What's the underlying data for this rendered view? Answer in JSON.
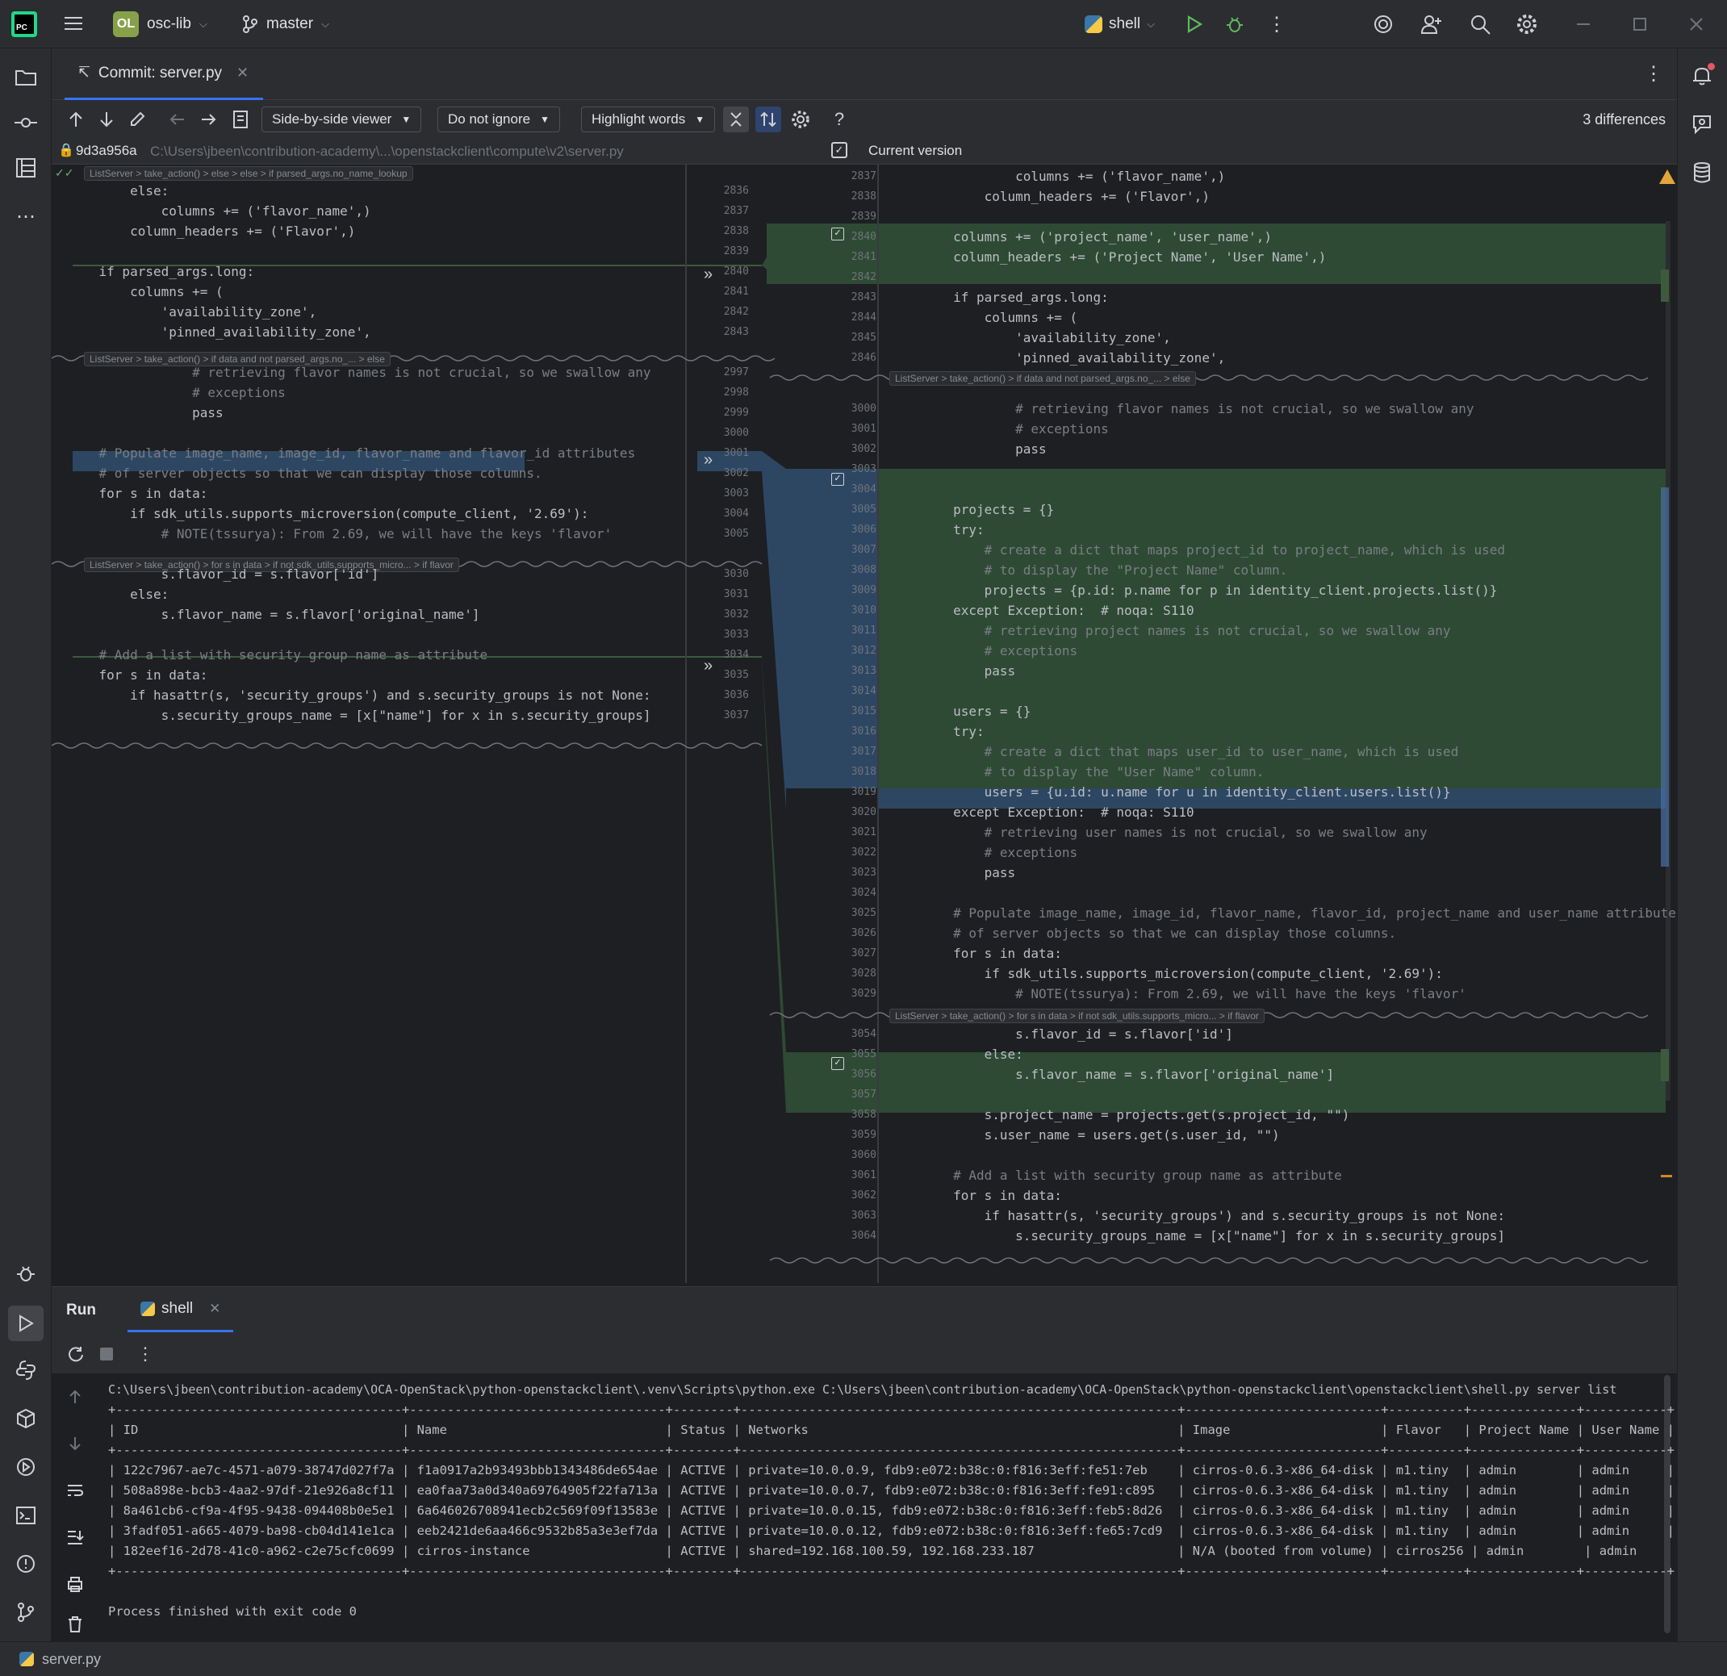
{
  "titlebar": {
    "project_badge": "OL",
    "project": "osc-lib",
    "branch": "master",
    "run_config": "shell"
  },
  "editor_tab": {
    "label": "Commit: server.py"
  },
  "toolbar": {
    "viewer": "Side-by-side viewer",
    "ignore": "Do not ignore",
    "highlight": "Highlight words",
    "differences": "3 differences"
  },
  "pathbar": {
    "revision": "9d3a956a",
    "path": "C:\\Users\\jbeen\\contribution-academy\\...\\openstackclient\\compute\\v2\\server.py",
    "current": "Current version"
  },
  "diff": {
    "left_crumbs": [
      "ListServer > take_action() > else > else > if parsed_args.no_name_lookup",
      "ListServer > take_action() > if data and not parsed_args.no_... > else",
      "ListServer > take_action() > for s in data > if not sdk_utils.supports_micro... > if flavor"
    ],
    "right_crumbs": [
      "ListServer > take_action() > if data and not parsed_args.no_... > else",
      "ListServer > take_action() > for s in data > if not sdk_utils.supports_micro... > if flavor"
    ],
    "left_lines": [
      {
        "n": "2836",
        "t": "        else:"
      },
      {
        "n": "2837",
        "t": "            columns += ('flavor_name',)"
      },
      {
        "n": "2838",
        "t": "        column_headers += ('Flavor',)"
      },
      {
        "n": "2839",
        "t": ""
      },
      {
        "n": "2840",
        "t": "    if parsed_args.long:"
      },
      {
        "n": "2841",
        "t": "        columns += ("
      },
      {
        "n": "2842",
        "t": "            'availability_zone',"
      },
      {
        "n": "2843",
        "t": "            'pinned_availability_zone',"
      },
      {
        "n": "2997",
        "t": "                # retrieving flavor names is not crucial, so we swallow any"
      },
      {
        "n": "2998",
        "t": "                # exceptions"
      },
      {
        "n": "2999",
        "t": "                pass"
      },
      {
        "n": "3000",
        "t": ""
      },
      {
        "n": "3001",
        "t": "    # Populate image_name, image_id, flavor_name and flavor_id attributes"
      },
      {
        "n": "3002",
        "t": "    # of server objects so that we can display those columns."
      },
      {
        "n": "3003",
        "t": "    for s in data:"
      },
      {
        "n": "3004",
        "t": "        if sdk_utils.supports_microversion(compute_client, '2.69'):"
      },
      {
        "n": "3005",
        "t": "            # NOTE(tssurya): From 2.69, we will have the keys 'flavor'"
      },
      {
        "n": "3030",
        "t": "            s.flavor_id = s.flavor['id']"
      },
      {
        "n": "3031",
        "t": "        else:"
      },
      {
        "n": "3032",
        "t": "            s.flavor_name = s.flavor['original_name']"
      },
      {
        "n": "3033",
        "t": ""
      },
      {
        "n": "3034",
        "t": "    # Add a list with security group name as attribute"
      },
      {
        "n": "3035",
        "t": "    for s in data:"
      },
      {
        "n": "3036",
        "t": "        if hasattr(s, 'security_groups') and s.security_groups is not None:"
      },
      {
        "n": "3037",
        "t": "            s.security_groups_name = [x[\"name\"] for x in s.security_groups]"
      }
    ],
    "right_lines": [
      {
        "n": "2837",
        "t": "                columns += ('flavor_name',)"
      },
      {
        "n": "2838",
        "t": "            column_headers += ('Flavor',)"
      },
      {
        "n": "2839",
        "t": ""
      },
      {
        "n": "2840",
        "t": "        columns += ('project_name', 'user_name',)"
      },
      {
        "n": "2841",
        "t": "        column_headers += ('Project Name', 'User Name',)"
      },
      {
        "n": "2842",
        "t": ""
      },
      {
        "n": "2843",
        "t": "        if parsed_args.long:"
      },
      {
        "n": "2844",
        "t": "            columns += ("
      },
      {
        "n": "2845",
        "t": "                'availability_zone',"
      },
      {
        "n": "2846",
        "t": "                'pinned_availability_zone',"
      },
      {
        "n": "3000",
        "t": "                # retrieving flavor names is not crucial, so we swallow any"
      },
      {
        "n": "3001",
        "t": "                # exceptions"
      },
      {
        "n": "3002",
        "t": "                pass"
      },
      {
        "n": "3003",
        "t": ""
      },
      {
        "n": "3004",
        "t": ""
      },
      {
        "n": "3005",
        "t": "        projects = {}"
      },
      {
        "n": "3006",
        "t": "        try:"
      },
      {
        "n": "3007",
        "t": "            # create a dict that maps project_id to project_name, which is used"
      },
      {
        "n": "3008",
        "t": "            # to display the \"Project Name\" column."
      },
      {
        "n": "3009",
        "t": "            projects = {p.id: p.name for p in identity_client.projects.list()}"
      },
      {
        "n": "3010",
        "t": "        except Exception:  # noqa: S110"
      },
      {
        "n": "3011",
        "t": "            # retrieving project names is not crucial, so we swallow any"
      },
      {
        "n": "3012",
        "t": "            # exceptions"
      },
      {
        "n": "3013",
        "t": "            pass"
      },
      {
        "n": "3014",
        "t": ""
      },
      {
        "n": "3015",
        "t": "        users = {}"
      },
      {
        "n": "3016",
        "t": "        try:"
      },
      {
        "n": "3017",
        "t": "            # create a dict that maps user_id to user_name, which is used"
      },
      {
        "n": "3018",
        "t": "            # to display the \"User Name\" column."
      },
      {
        "n": "3019",
        "t": "            users = {u.id: u.name for u in identity_client.users.list()}"
      },
      {
        "n": "3020",
        "t": "        except Exception:  # noqa: S110"
      },
      {
        "n": "3021",
        "t": "            # retrieving user names is not crucial, so we swallow any"
      },
      {
        "n": "3022",
        "t": "            # exceptions"
      },
      {
        "n": "3023",
        "t": "            pass"
      },
      {
        "n": "3024",
        "t": ""
      },
      {
        "n": "3025",
        "t": "        # Populate image_name, image_id, flavor_name, flavor_id, project_name and user_name attributes"
      },
      {
        "n": "3026",
        "t": "        # of server objects so that we can display those columns."
      },
      {
        "n": "3027",
        "t": "        for s in data:"
      },
      {
        "n": "3028",
        "t": "            if sdk_utils.supports_microversion(compute_client, '2.69'):"
      },
      {
        "n": "3029",
        "t": "                # NOTE(tssurya): From 2.69, we will have the keys 'flavor'"
      },
      {
        "n": "3054",
        "t": "                s.flavor_id = s.flavor['id']"
      },
      {
        "n": "3055",
        "t": "            else:"
      },
      {
        "n": "3056",
        "t": "                s.flavor_name = s.flavor['original_name']"
      },
      {
        "n": "3057",
        "t": ""
      },
      {
        "n": "3058",
        "t": "            s.project_name = projects.get(s.project_id, \"\")"
      },
      {
        "n": "3059",
        "t": "            s.user_name = users.get(s.user_id, \"\")"
      },
      {
        "n": "3060",
        "t": ""
      },
      {
        "n": "3061",
        "t": "        # Add a list with security group name as attribute"
      },
      {
        "n": "3062",
        "t": "        for s in data:"
      },
      {
        "n": "3063",
        "t": "            if hasattr(s, 'security_groups') and s.security_groups is not None:"
      },
      {
        "n": "3064",
        "t": "                s.security_groups_name = [x[\"name\"] for x in s.security_groups]"
      }
    ]
  },
  "run": {
    "tab_run": "Run",
    "tab_shell": "shell",
    "console": [
      "C:\\Users\\jbeen\\contribution-academy\\OCA-OpenStack\\python-openstackclient\\.venv\\Scripts\\python.exe C:\\Users\\jbeen\\contribution-academy\\OCA-OpenStack\\python-openstackclient\\openstackclient\\shell.py server list",
      "+--------------------------------------+----------------------------------+--------+----------------------------------------------------------+--------------------------+----------+--------------+-----------+",
      "| ID                                   | Name                             | Status | Networks                                                 | Image                    | Flavor   | Project Name | User Name |",
      "+--------------------------------------+----------------------------------+--------+----------------------------------------------------------+--------------------------+----------+--------------+-----------+",
      "| 122c7967-ae7c-4571-a079-38747d027f7a | f1a0917a2b93493bbb1343486de654ae | ACTIVE | private=10.0.0.9, fdb9:e072:b38c:0:f816:3eff:fe51:7eb    | cirros-0.6.3-x86_64-disk | m1.tiny  | admin        | admin     |",
      "| 508a898e-bcb3-4aa2-97df-21e926a8cf11 | ea0faa73a0d340a69764905f22fa713a | ACTIVE | private=10.0.0.7, fdb9:e072:b38c:0:f816:3eff:fe91:c895   | cirros-0.6.3-x86_64-disk | m1.tiny  | admin        | admin     |",
      "| 8a461cb6-cf9a-4f95-9438-094408b0e5e1 | 6a646026708941ecb2c569f09f13583e | ACTIVE | private=10.0.0.15, fdb9:e072:b38c:0:f816:3eff:feb5:8d26  | cirros-0.6.3-x86_64-disk | m1.tiny  | admin        | admin     |",
      "| 3fadf051-a665-4079-ba98-cb04d141e1ca | eeb2421de6aa466c9532b85a3e3ef7da | ACTIVE | private=10.0.0.12, fdb9:e072:b38c:0:f816:3eff:fe65:7cd9  | cirros-0.6.3-x86_64-disk | m1.tiny  | admin        | admin     |",
      "| 182eef16-2d78-41c0-a962-c2e75cfc0699 | cirros-instance                  | ACTIVE | shared=192.168.100.59, 192.168.233.187                   | N/A (booted from volume) | cirros256 | admin        | admin     |",
      "+--------------------------------------+----------------------------------+--------+----------------------------------------------------------+--------------------------+----------+--------------+-----------+",
      "",
      "Process finished with exit code 0"
    ]
  },
  "status": {
    "file": "server.py"
  },
  "colors": {
    "accent": "#3574f0",
    "added": "#2e4a34",
    "changed": "#2d4763",
    "run": "#5fb85f"
  }
}
